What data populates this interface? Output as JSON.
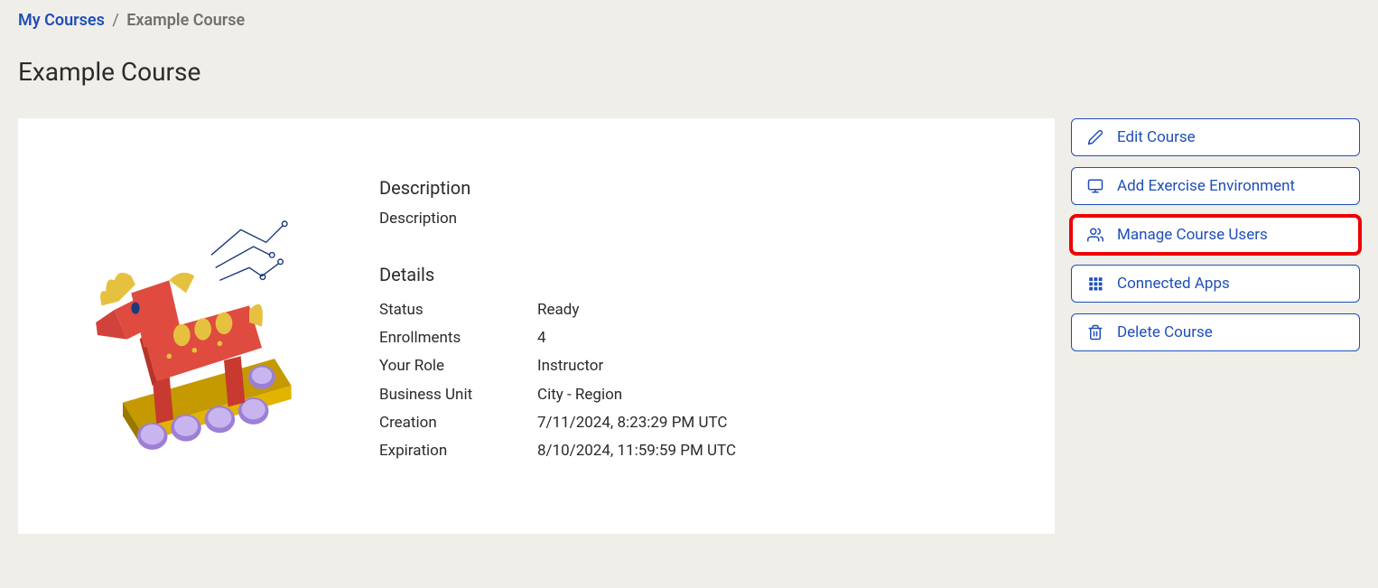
{
  "breadcrumb": {
    "link_label": "My Courses",
    "separator": "/",
    "current": "Example Course"
  },
  "page_title": "Example Course",
  "description": {
    "heading": "Description",
    "text": "Description"
  },
  "details": {
    "heading": "Details",
    "rows": [
      {
        "label": "Status",
        "value": "Ready"
      },
      {
        "label": "Enrollments",
        "value": "4"
      },
      {
        "label": "Your Role",
        "value": "Instructor"
      },
      {
        "label": "Business Unit",
        "value": "City - Region"
      },
      {
        "label": "Creation",
        "value": "7/11/2024, 8:23:29 PM UTC"
      },
      {
        "label": "Expiration",
        "value": "8/10/2024, 11:59:59 PM UTC"
      }
    ]
  },
  "actions": {
    "edit": "Edit Course",
    "add_env": "Add Exercise Environment",
    "manage_users": "Manage Course Users",
    "connected_apps": "Connected Apps",
    "delete": "Delete Course"
  },
  "colors": {
    "accent": "#1f4fb8",
    "highlight": "#ee0000"
  }
}
